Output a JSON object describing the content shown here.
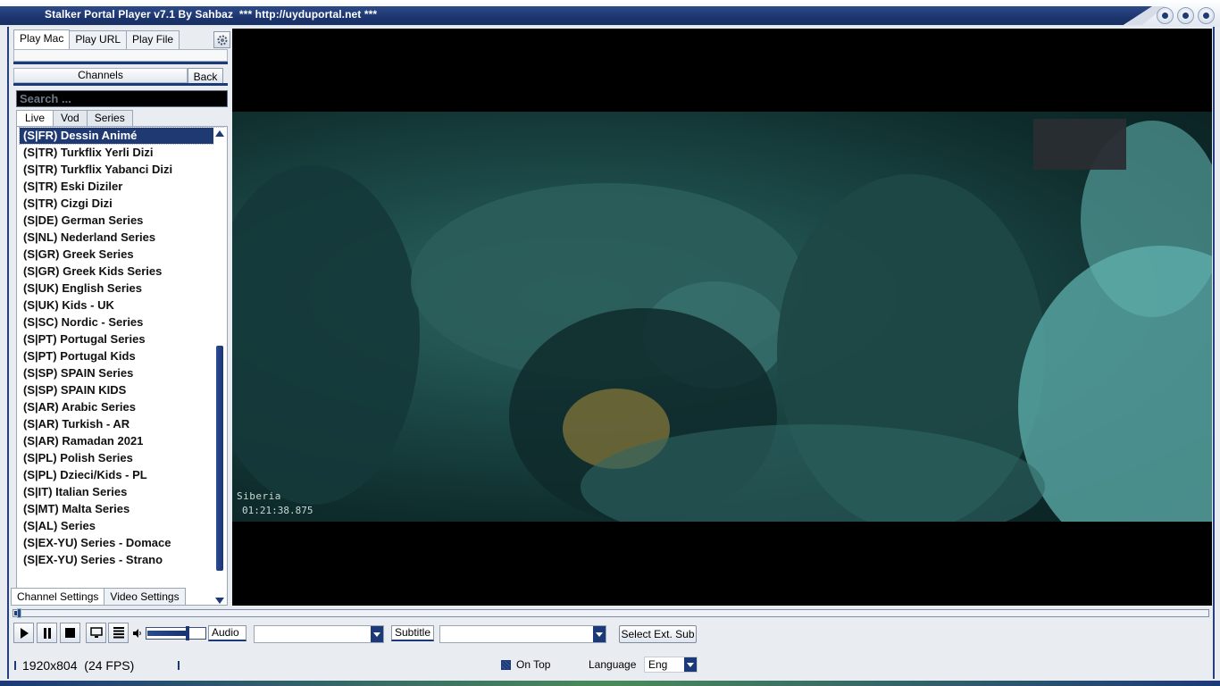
{
  "window": {
    "title": "Stalker Portal Player v7.1 By Sahbaz  *** http://uyduportal.net ***"
  },
  "top_tabs": [
    {
      "label": "Play Mac",
      "active": true
    },
    {
      "label": "Play URL",
      "active": false
    },
    {
      "label": "Play File",
      "active": false
    }
  ],
  "panel": {
    "channels_label": "Channels",
    "back_label": "Back",
    "search_placeholder": "Search ..."
  },
  "sub_tabs": [
    {
      "label": "Live",
      "active": true
    },
    {
      "label": "Vod",
      "active": false
    },
    {
      "label": "Series",
      "active": false
    }
  ],
  "channels": [
    "(S|FR) Dessin Animé",
    "(S|TR) Turkflix Yerli Dizi",
    "(S|TR) Turkflix Yabanci Dizi",
    "(S|TR) Eski Diziler",
    "(S|TR) Cizgi Dizi",
    "(S|DE) German Series",
    "(S|NL) Nederland Series",
    "(S|GR) Greek Series",
    "(S|GR) Greek Kids Series",
    "(S|UK) English Series",
    "(S|UK) Kids - UK",
    "(S|SC) Nordic - Series",
    "(S|PT) Portugal Series",
    "(S|PT) Portugal Kids",
    "(S|SP) SPAIN Series",
    "(S|SP) SPAIN KIDS",
    "(S|AR) Arabic Series",
    "(S|AR) Turkish - AR",
    "(S|AR) Ramadan 2021",
    "(S|PL) Polish Series",
    "(S|PL) Dzieci/Kids - PL",
    "(S|IT) Italian Series",
    "(S|MT) Malta Series",
    "(S|AL) Series",
    "(S|EX-YU) Series - Domace",
    "(S|EX-YU) Series - Strano"
  ],
  "selected_channel_index": 0,
  "bottom_tabs": [
    {
      "label": "Channel Settings",
      "active": true
    },
    {
      "label": "Video Settings",
      "active": false
    }
  ],
  "video": {
    "caption_title": "Siberia",
    "caption_time": "01:21:38.875"
  },
  "playback": {
    "progress": 0.003,
    "volume": 0.72
  },
  "controls": {
    "audio_label": "Audio",
    "audio_value": "",
    "subtitle_label": "Subtitle",
    "subtitle_value": "",
    "ext_sub_label": "Select Ext. Sub"
  },
  "status": {
    "resolution": "1920x804  (24 FPS)",
    "on_top_label": "On Top",
    "on_top_checked": true,
    "language_label": "Language",
    "language_value": "Eng"
  },
  "colors": {
    "accent": "#1d3a78",
    "selected_row": "#1f3973"
  }
}
